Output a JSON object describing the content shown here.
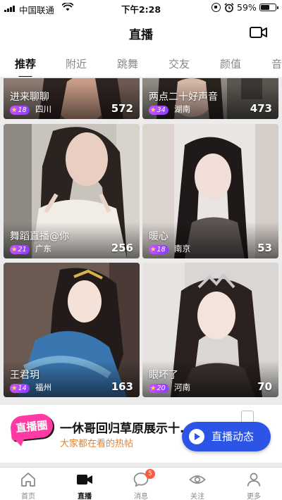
{
  "status_bar": {
    "carrier": "中国联通",
    "time": "下午2:28",
    "battery": "59%"
  },
  "header": {
    "title": "直播",
    "camera_icon": "video-camera-icon"
  },
  "tabs": [
    {
      "label": "推荐",
      "active": true
    },
    {
      "label": "附近",
      "active": false
    },
    {
      "label": "跳舞",
      "active": false
    },
    {
      "label": "交友",
      "active": false
    },
    {
      "label": "颜值",
      "active": false
    },
    {
      "label": "音",
      "active": false
    }
  ],
  "cards": [
    {
      "name": "进来聊聊",
      "level": "18",
      "city": "四川",
      "count": "572"
    },
    {
      "name": "两点二十好声音",
      "level": "34",
      "city": "湖南",
      "count": "473"
    },
    {
      "name": "舞蹈直播@你",
      "level": "21",
      "city": "广东",
      "count": "256"
    },
    {
      "name": "暖心",
      "level": "18",
      "city": "南京",
      "count": "53"
    },
    {
      "name": "王君玥",
      "level": "14",
      "city": "福州",
      "count": "163"
    },
    {
      "name": "眼坏了",
      "level": "20",
      "city": "河南",
      "count": "70"
    }
  ],
  "promo": {
    "logo_text": "直播圈",
    "headline": "一休哥回归草原展示十.",
    "subtitle": "大家都在看的热帖",
    "button_label": "直播动态"
  },
  "tab_bar": [
    {
      "label": "首页",
      "icon": "home-icon",
      "active": false
    },
    {
      "label": "直播",
      "icon": "video-camera-icon",
      "active": true
    },
    {
      "label": "消息",
      "icon": "chat-bubble-icon",
      "active": false,
      "badge": "5"
    },
    {
      "label": "关注",
      "icon": "eye-icon",
      "active": false
    },
    {
      "label": "更多",
      "icon": "person-icon",
      "active": false
    }
  ],
  "colors": {
    "accent_blue": "#2c55e8",
    "badge_purple": "#b04cff",
    "promo_pink": "#ff3aa4",
    "subtitle_orange": "#e8822a"
  }
}
